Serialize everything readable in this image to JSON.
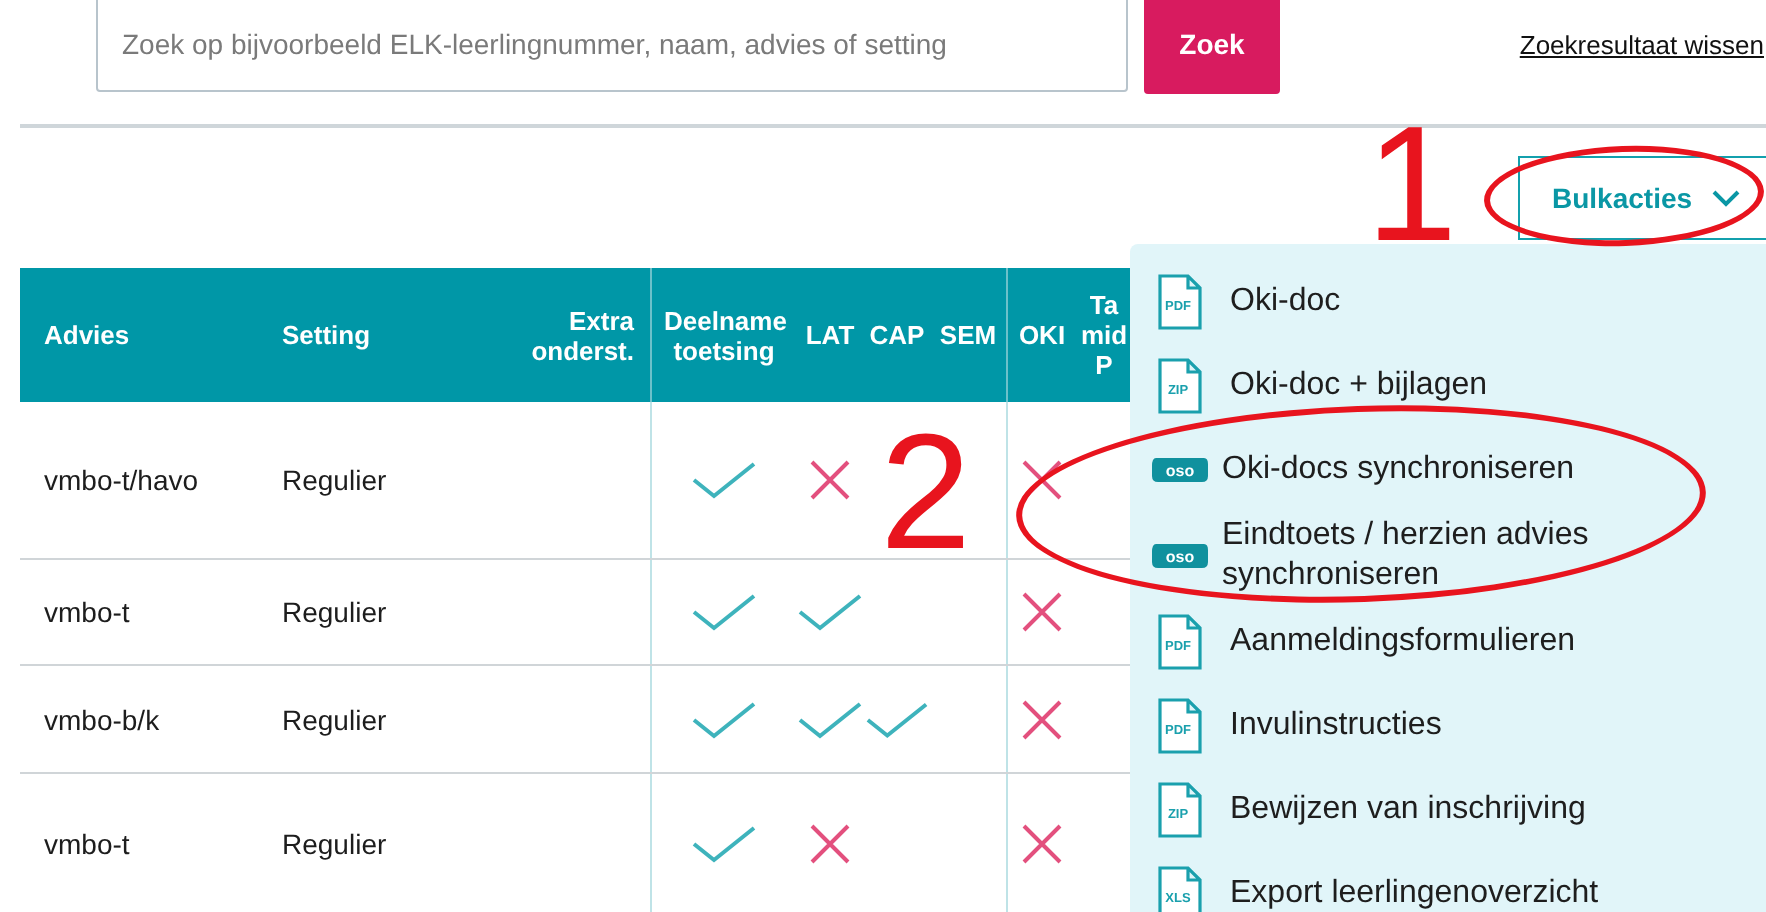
{
  "search": {
    "placeholder": "Zoek op bijvoorbeeld ELK-leerlingnummer, naam, advies of setting",
    "button": "Zoek",
    "clear_link": "Zoekresultaat wissen"
  },
  "bulk_button": {
    "label": "Bulkacties",
    "expanded": true
  },
  "table": {
    "columns": [
      {
        "label": "Advies"
      },
      {
        "label": "Setting"
      },
      {
        "label": "Extra onderst."
      },
      {
        "label": "Deelname toetsing"
      },
      {
        "label": "LAT"
      },
      {
        "label": "CAP"
      },
      {
        "label": "SEM"
      },
      {
        "label": "OKI"
      },
      {
        "lines": [
          "Ta",
          "mid",
          "P"
        ]
      }
    ],
    "rows": [
      {
        "advies": "vmbo-t/havo",
        "setting": "Regulier",
        "deelname": true,
        "lat": false,
        "oki": false
      },
      {
        "advies": "vmbo-t",
        "setting": "Regulier",
        "deelname": true,
        "lat": true,
        "oki": false
      },
      {
        "advies": "vmbo-b/k",
        "setting": "Regulier",
        "deelname": true,
        "lat": true,
        "cap": true,
        "oki": false
      },
      {
        "advies": "vmbo-t",
        "setting": "Regulier",
        "deelname": true,
        "lat": false,
        "oki": false
      }
    ]
  },
  "menu": [
    {
      "kind": "file",
      "icon_text": "PDF",
      "label": "Oki-doc"
    },
    {
      "kind": "file",
      "icon_text": "ZIP",
      "label": "Oki-doc + bijlagen"
    },
    {
      "kind": "oso",
      "icon_text": "oso",
      "label": "Oki-docs synchroniseren"
    },
    {
      "kind": "oso",
      "icon_text": "oso",
      "label": "Eindtoets / herzien advies synchroniseren"
    },
    {
      "kind": "file",
      "icon_text": "PDF",
      "label": "Aanmeldingsformulieren"
    },
    {
      "kind": "file",
      "icon_text": "PDF",
      "label": "Invulinstructies"
    },
    {
      "kind": "file",
      "icon_text": "ZIP",
      "label": "Bewijzen van inschrijving"
    },
    {
      "kind": "file",
      "icon_text": "XLS",
      "label": "Export leerlingenoverzicht"
    }
  ],
  "annotations": [
    {
      "number": "1"
    },
    {
      "number": "2"
    }
  ]
}
